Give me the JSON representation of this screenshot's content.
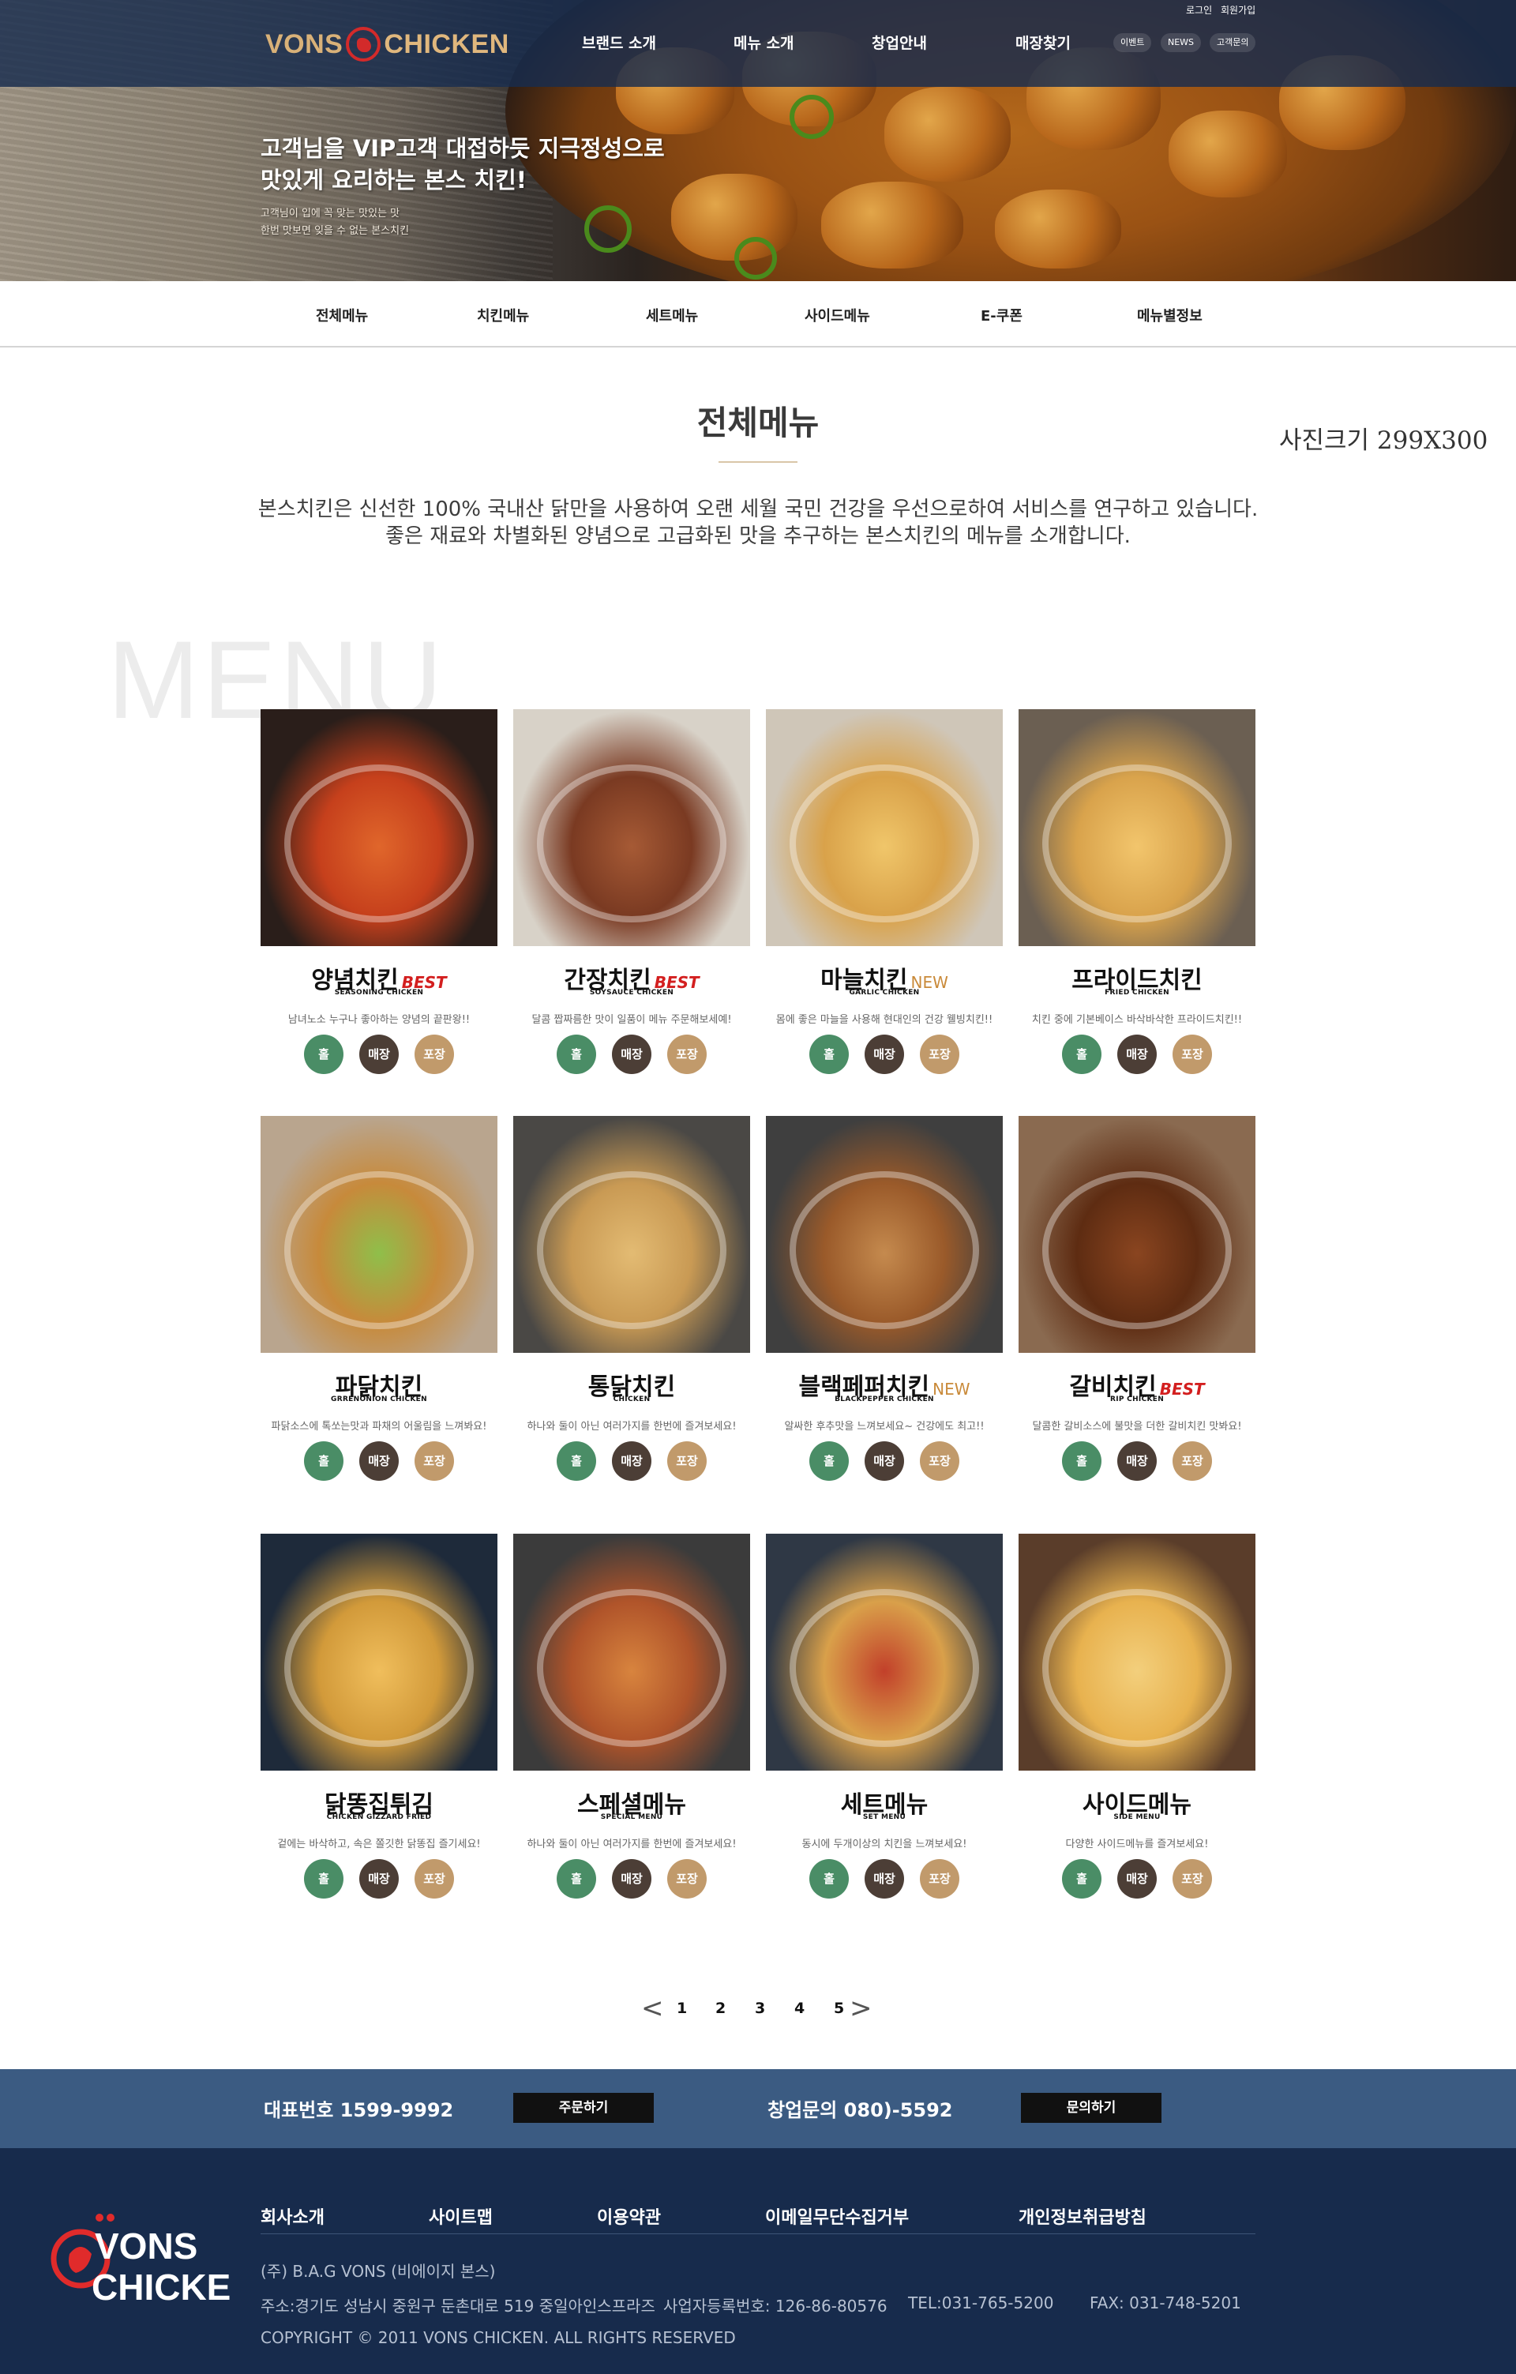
{
  "header": {
    "logo_left": "VONS",
    "logo_right": "CHICKEN",
    "util_links": [
      "로그인",
      "회원가입"
    ],
    "gnb": [
      "브랜드 소개",
      "메뉴 소개",
      "창업안내",
      "매장찾기"
    ],
    "pills": [
      "이벤트",
      "NEWS",
      "고객문의"
    ]
  },
  "hero": {
    "headline_1": "고객님을 VIP고객 대접하듯 지극정성으로",
    "headline_2": "맛있게 요리하는 본스 치킨!",
    "sub_1": "고객님이 입에 꼭 맞는 맛있는 맛",
    "sub_2": "한번 맛보면 잊을 수 없는 본스치킨"
  },
  "subnav": [
    "전체메뉴",
    "치킨메뉴",
    "세트메뉴",
    "사이드메뉴",
    "E-쿠폰",
    "메뉴별정보"
  ],
  "page": {
    "title": "전체메뉴",
    "size_note": "사진크기 299X300",
    "intro_1": "본스치킨은 신선한 100% 국내산 닭만을 사용하여 오랜 세월 국민 건강을 우선으로하여 서비스를 연구하고 있습니다.",
    "intro_2": "좋은 재료와 차별화된 양념으로 고급화된 맛을 추구하는 본스치킨의 메뉴를 소개합니다.",
    "watermark": "MENU"
  },
  "menu_items": [
    {
      "name": "양념치킨",
      "badge": "BEST",
      "en": "SEASONING CHICKEN",
      "desc": "남녀노소 누구나 좋아하는 양념의 끝판왕!!"
    },
    {
      "name": "간장치킨",
      "badge": "BEST",
      "en": "SOYSAUCE CHICKEN",
      "desc": "달콤 짭짜름한 맛이 일품이 메뉴 주문해보세예!"
    },
    {
      "name": "마늘치킨",
      "badge": "NEW",
      "en": "GARLIC CHICKEN",
      "desc": "몸에 좋은 마늘을 사용해 현대인의 건강 웰빙치킨!!"
    },
    {
      "name": "프라이드치킨",
      "badge": "",
      "en": "FRIED CHICKEN",
      "desc": "치킨 중에 기본베이스 바삭바삭한 프라이드치킨!!"
    },
    {
      "name": "파닭치킨",
      "badge": "",
      "en": "GRRENONION CHICKEN",
      "desc": "파닭소스에 톡쏘는맛과 파채의 어울림을 느껴봐요!"
    },
    {
      "name": "통닭치킨",
      "badge": "",
      "en": "CHICKEN",
      "desc": "하나와 둘이 아닌 여러가지를 한번에 즐겨보세요!"
    },
    {
      "name": "블랙페퍼치킨",
      "badge": "NEW",
      "en": "BLACKPEPPER CHICKEN",
      "desc": "알싸한 후추맛을 느껴보세요~ 건강에도 최고!!"
    },
    {
      "name": "갈비치킨",
      "badge": "BEST",
      "en": "RIP CHICKEN",
      "desc": "달콤한 갈비소스에 불맛을 더한 갈비치킨 맛봐요!"
    },
    {
      "name": "닭똥집튀김",
      "badge": "",
      "en": "CHICKEN GIZZARD FRIED",
      "desc": "겉에는 바삭하고, 속은 쫄깃한 닭똥집 즐기세요!"
    },
    {
      "name": "스페셜메뉴",
      "badge": "",
      "en": "SPECIAL MENU",
      "desc": "하나와 둘이 아닌 여러가지를 한번에 즐겨보세요!"
    },
    {
      "name": "세트메뉴",
      "badge": "",
      "en": "SET MENU",
      "desc": "동시에 두개이상의 치킨을 느껴보세요!"
    },
    {
      "name": "사이드메뉴",
      "badge": "",
      "en": "SIDE MENU",
      "desc": "다양한 사이드메뉴를 즐겨보세요!"
    }
  ],
  "card_buttons": {
    "home": "홀",
    "store": "매장",
    "pack": "포장"
  },
  "pagination": {
    "pages": [
      "1",
      "2",
      "3",
      "4",
      "5"
    ],
    "prev": "<",
    "next": ">"
  },
  "cta": {
    "phone_label": "대표번호 1599-9992",
    "order_btn": "주문하기",
    "startup_label": "창업문의 080)-5592",
    "inquiry_btn": "문의하기"
  },
  "footer": {
    "logo_line1": "VONS",
    "logo_line2": "CHICKEN",
    "links": [
      "회사소개",
      "사이트맵",
      "이용약관",
      "이메일무단수집거부",
      "개인정보취급방침"
    ],
    "company": "(주) B.A.G VONS (비에이지 본스)",
    "address": "주소:경기도 성남시 중원구 둔촌대로 519 중일아인스프라즈",
    "biz_no": "사업자등록번호: 126-86-80576",
    "tel": "TEL:031-765-5200",
    "fax": "FAX: 031-748-5201",
    "copyright": "COPYRIGHT © 2011 VONS CHICKEN. ALL RIGHTS RESERVED"
  },
  "colors": {
    "topbar": "#172c4e",
    "cta": "#3b5b82",
    "footer": "#172b4c",
    "btn_home": "#4a8d66",
    "btn_store": "#4c3e36",
    "btn_pack": "#c19a6b",
    "best": "#d31f1f",
    "new": "#c98a3a"
  }
}
